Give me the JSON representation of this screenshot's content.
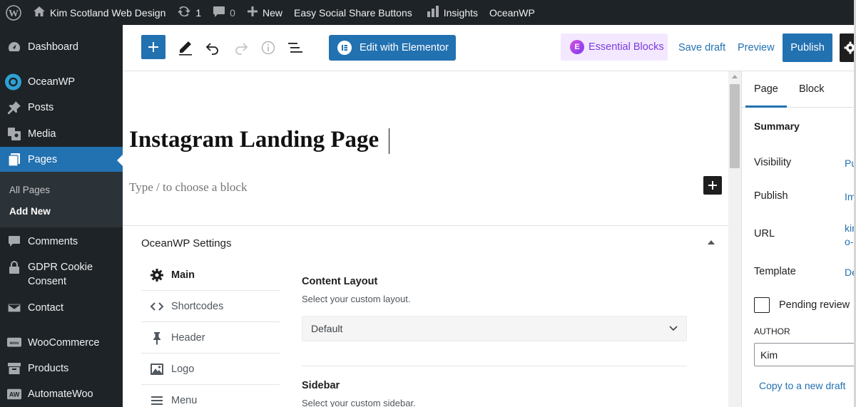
{
  "admin_bar": {
    "site_name": "Kim Scotland Web Design",
    "updates_count": "1",
    "comments_count": "0",
    "new_label": "New",
    "plugin_label": "Easy Social Share Buttons",
    "insights_label": "Insights",
    "theme_label": "OceanWP"
  },
  "sidebar": {
    "dashboard": "Dashboard",
    "oceanwp": "OceanWP",
    "posts": "Posts",
    "media": "Media",
    "pages": "Pages",
    "all_pages": "All Pages",
    "add_new": "Add New",
    "comments": "Comments",
    "gdpr": "GDPR Cookie Consent",
    "contact": "Contact",
    "woocommerce": "WooCommerce",
    "products": "Products",
    "automatewoo": "AutomateWoo",
    "accent_color": "#2271b1"
  },
  "toolbar": {
    "elementor_label": "Edit with Elementor",
    "essential_label": "Essential Blocks",
    "save_draft_label": "Save draft",
    "preview_label": "Preview",
    "publish_label": "Publish"
  },
  "editor": {
    "title": "Instagram Landing Page",
    "block_placeholder": "Type / to choose a block"
  },
  "oceanwp_settings": {
    "title": "OceanWP Settings",
    "tabs": [
      {
        "label": "Main",
        "icon": "gear-icon"
      },
      {
        "label": "Shortcodes",
        "icon": "code-icon"
      },
      {
        "label": "Header",
        "icon": "pin-icon"
      },
      {
        "label": "Logo",
        "icon": "image-icon"
      },
      {
        "label": "Menu",
        "icon": "menu-icon"
      }
    ],
    "content_layout_label": "Content Layout",
    "content_layout_desc": "Select your custom layout.",
    "content_layout_value": "Default",
    "sidebar_label": "Sidebar",
    "sidebar_desc": "Select your custom sidebar."
  },
  "settings_panel": {
    "tab_page": "Page",
    "tab_block": "Block",
    "summary": "Summary",
    "visibility_label": "Visibility",
    "visibility_value": "Pu",
    "publish_label": "Publish",
    "publish_value": "Im",
    "url_label": "URL",
    "url_value_1": "kir",
    "url_value_2": "o-",
    "template_label": "Template",
    "template_value": "De",
    "pending_review": "Pending review",
    "author_label": "AUTHOR",
    "author_value": "Kim",
    "copy_draft": "Copy to a new draft"
  }
}
